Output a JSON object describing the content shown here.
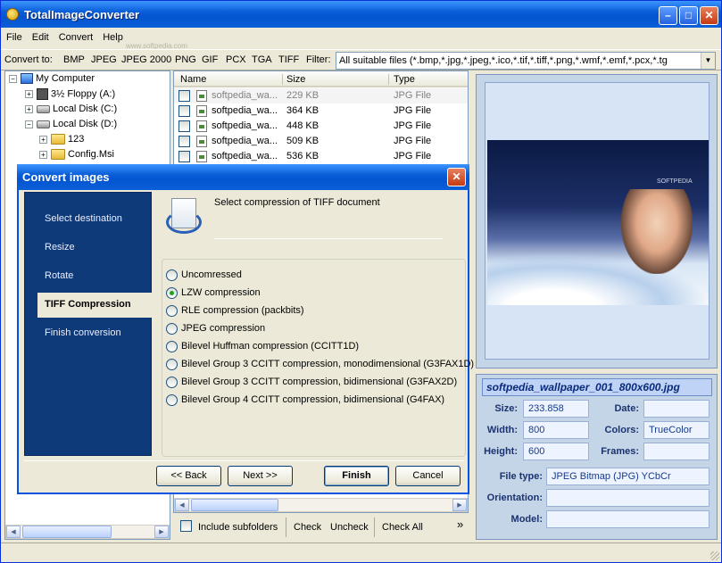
{
  "app": {
    "title": "TotalImageConverter"
  },
  "watermark": "www.softpedia.com",
  "menu": [
    "File",
    "Edit",
    "Convert",
    "Help"
  ],
  "convert_bar": {
    "label": "Convert to:",
    "formats": [
      "BMP",
      "JPEG",
      "JPEG 2000",
      "PNG",
      "GIF",
      "PCX",
      "TGA",
      "TIFF"
    ],
    "filter_label": "Filter:",
    "filter_value": "All suitable files (*.bmp,*.jpg,*.jpeg,*.ico,*.tif,*.tiff,*.png,*.wmf,*.emf,*.pcx,*.tg"
  },
  "tree": {
    "items": [
      {
        "label": "My Computer",
        "icon": "computer-icon"
      },
      {
        "label": "3½ Floppy (A:)",
        "icon": "floppy-icon"
      },
      {
        "label": "Local Disk (C:)",
        "icon": "disk-icon"
      },
      {
        "label": "Local Disk (D:)",
        "icon": "disk-icon"
      },
      {
        "label": "123",
        "icon": "folder-icon"
      },
      {
        "label": "Config.Msi",
        "icon": "folder-icon"
      }
    ]
  },
  "filelist": {
    "columns": [
      "Name",
      "Size",
      "Type"
    ],
    "rows": [
      {
        "name": "softpedia_wa...",
        "size": "229 KB",
        "type": "JPG File"
      },
      {
        "name": "softpedia_wa...",
        "size": "364 KB",
        "type": "JPG File"
      },
      {
        "name": "softpedia_wa...",
        "size": "448 KB",
        "type": "JPG File"
      },
      {
        "name": "softpedia_wa...",
        "size": "509 KB",
        "type": "JPG File"
      },
      {
        "name": "softpedia_wa...",
        "size": "536 KB",
        "type": "JPG File"
      }
    ]
  },
  "bottom_bar": {
    "include_subfolders": "Include subfolders",
    "check": "Check",
    "uncheck": "Uncheck",
    "check_all": "Check All",
    "more": "»"
  },
  "preview": {
    "logo_text": "SOFTPEDIA"
  },
  "info": {
    "filename": "softpedia_wallpaper_001_800x600.jpg",
    "size_label": "Size:",
    "size_value": "233.858",
    "date_label": "Date:",
    "date_value": "",
    "width_label": "Width:",
    "width_value": "800",
    "colors_label": "Colors:",
    "colors_value": "TrueColor",
    "height_label": "Height:",
    "height_value": "600",
    "frames_label": "Frames:",
    "frames_value": "",
    "filetype_label": "File type:",
    "filetype_value": "JPEG Bitmap (JPG) YCbCr",
    "orientation_label": "Orientation:",
    "orientation_value": "",
    "model_label": "Model:",
    "model_value": ""
  },
  "dialog": {
    "title": "Convert images",
    "steps": [
      "Select destination",
      "Resize",
      "Rotate",
      "TIFF Compression",
      "Finish conversion"
    ],
    "active_step": 3,
    "header_text": "Select compression of TIFF document",
    "options": [
      "Uncomressed",
      "LZW compression",
      "RLE compression (packbits)",
      "JPEG compression",
      "Bilevel Huffman compression (CCITT1D)",
      "Bilevel Group 3 CCITT compression, monodimensional (G3FAX1D)",
      "Bilevel Group 3 CCITT compression, bidimensional (G3FAX2D)",
      "Bilevel Group 4 CCITT compression, bidimensional (G4FAX)"
    ],
    "selected_option": 1,
    "buttons": {
      "back": "<< Back",
      "next": "Next >>",
      "finish": "Finish",
      "cancel": "Cancel"
    }
  }
}
